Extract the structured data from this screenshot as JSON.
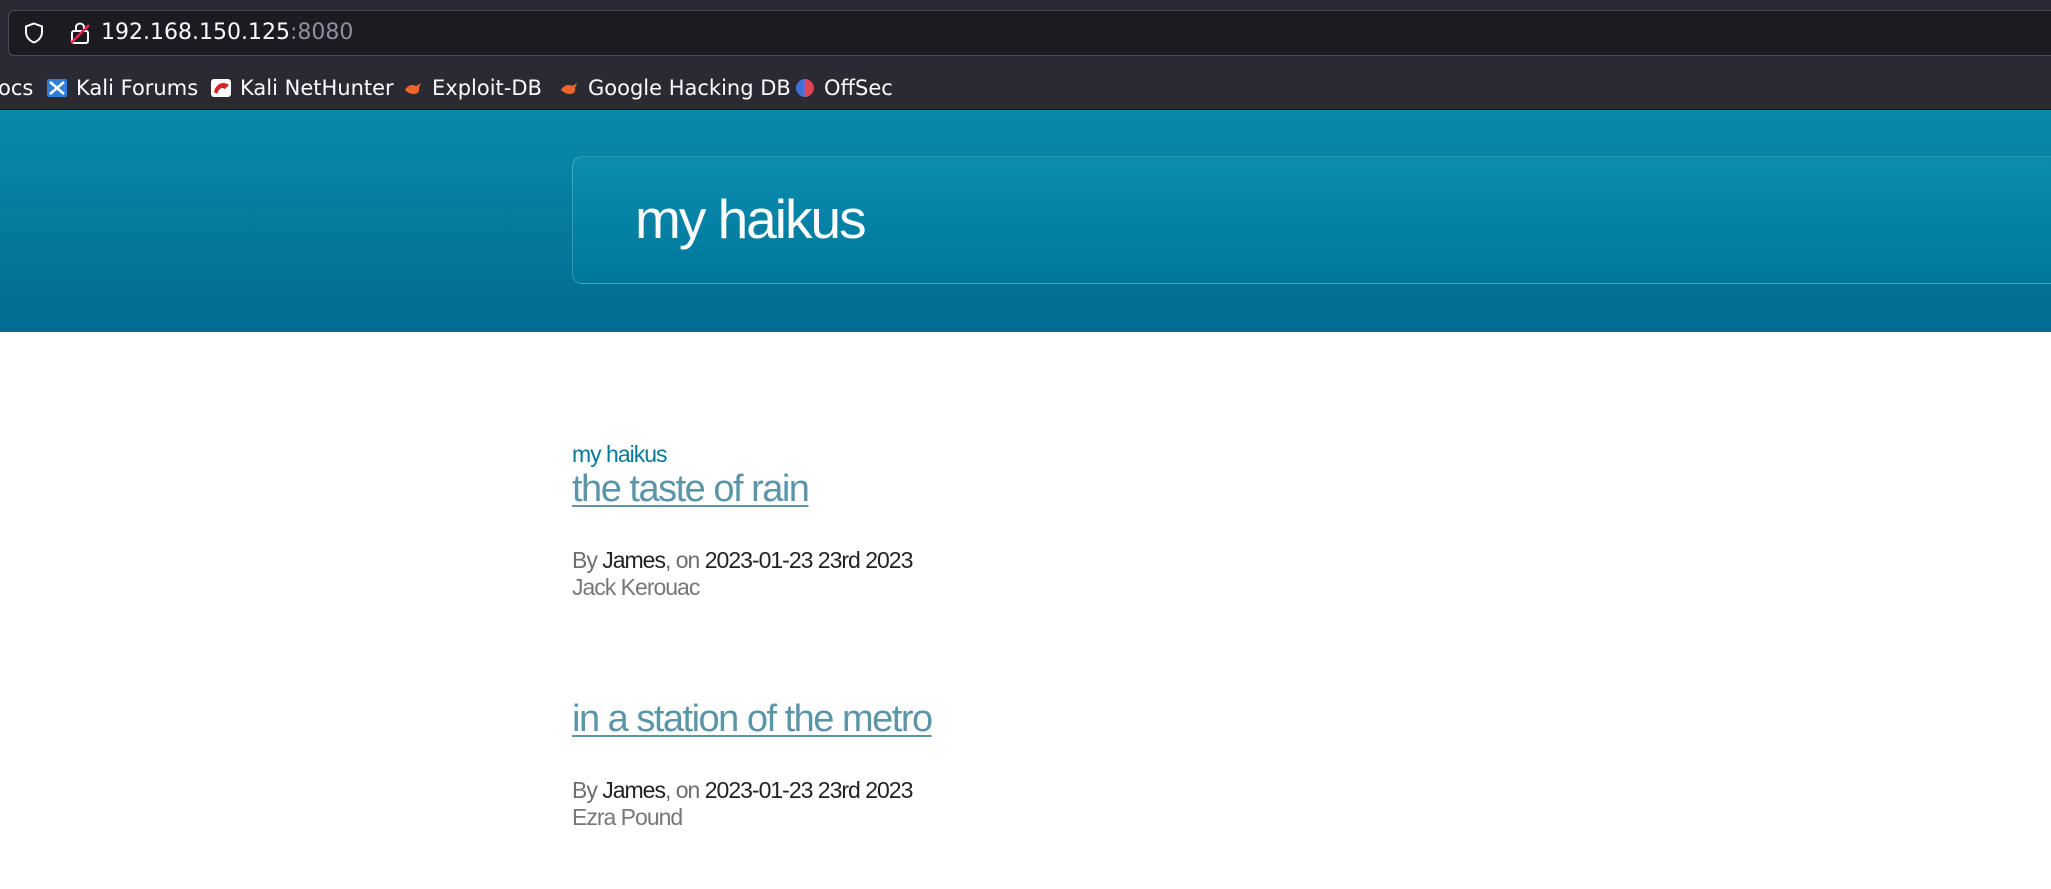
{
  "browser": {
    "url_host": "192.168.150.125",
    "url_port": ":8080",
    "bookmarks": [
      {
        "label": "ocs",
        "icon": "docs-icon"
      },
      {
        "label": "Kali Forums",
        "icon": "kali-forums-icon"
      },
      {
        "label": "Kali NetHunter",
        "icon": "kali-nethunter-icon"
      },
      {
        "label": "Exploit-DB",
        "icon": "exploit-db-icon"
      },
      {
        "label": "Google Hacking DB",
        "icon": "ghdb-icon"
      },
      {
        "label": "OffSec",
        "icon": "offsec-icon"
      }
    ]
  },
  "header": {
    "site_title": "my haikus"
  },
  "main": {
    "blog_link": "my haikus",
    "posts": [
      {
        "title": "the taste of rain",
        "by": "By",
        "author": "James",
        "on": ", on",
        "date": "2023-01-23 23rd 2023",
        "excerpt": "Jack Kerouac"
      },
      {
        "title": "in a station of the metro",
        "by": "By",
        "author": "James",
        "on": ", on",
        "date": "2023-01-23 23rd 2023",
        "excerpt": "Ezra Pound"
      }
    ]
  },
  "colors": {
    "chrome_bg": "#2b2a33",
    "urlbar_bg": "#1c1b22",
    "banner_top": "#0a89ab",
    "banner_bottom": "#006c91",
    "link": "#06799b",
    "post_title": "#5b95a8"
  }
}
